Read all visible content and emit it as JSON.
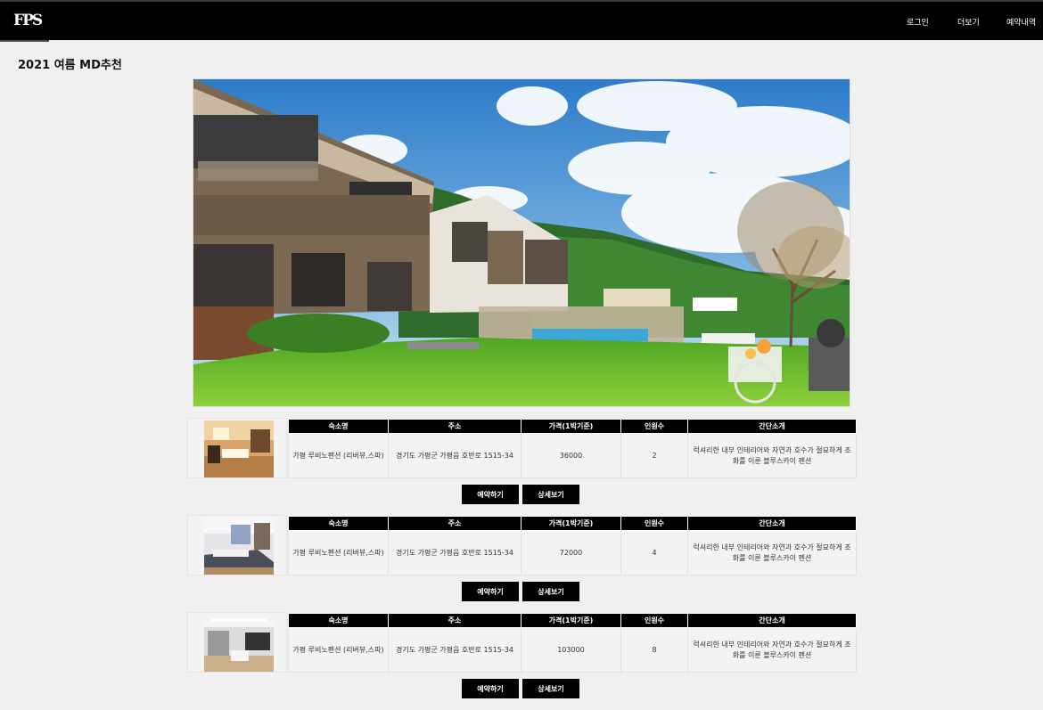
{
  "header": {
    "logo": "FPS",
    "nav": {
      "login": "로그인",
      "more": "더보기",
      "reservations": "예약내역"
    }
  },
  "page": {
    "title": "2021 여름 MD추천"
  },
  "table_headers": {
    "name": "숙소명",
    "address": "주소",
    "price": "가격(1박기준)",
    "capacity": "인원수",
    "intro": "간단소개"
  },
  "buttons": {
    "book": "예약하기",
    "detail": "상세보기"
  },
  "listings": [
    {
      "name": "가평 루비노펜션 (리버뷰,스파)",
      "address": "경기도 가평군 가평읍 호반로 1515-34",
      "price": "36000",
      "capacity": "2",
      "intro": "럭셔리한 내부 인테리어와 자연과 호수가 절묘하게 조화를 이룬 블루스카이 펜션"
    },
    {
      "name": "가평 루비노펜션 (리버뷰,스파)",
      "address": "경기도 가평군 가평읍 호반로 1515-34",
      "price": "72000",
      "capacity": "4",
      "intro": "럭셔리한 내부 인테리어와 자연과 호수가 절묘하게 조화를 이룬 블루스카이 펜션"
    },
    {
      "name": "가평 루비노펜션 (리버뷰,스파)",
      "address": "경기도 가평군 가평읍 호반로 1515-34",
      "price": "103000",
      "capacity": "8",
      "intro": "럭셔리한 내부 인테리어와 자연과 호수가 절묘하게 조화를 이룬 블루스카이 펜션"
    }
  ]
}
